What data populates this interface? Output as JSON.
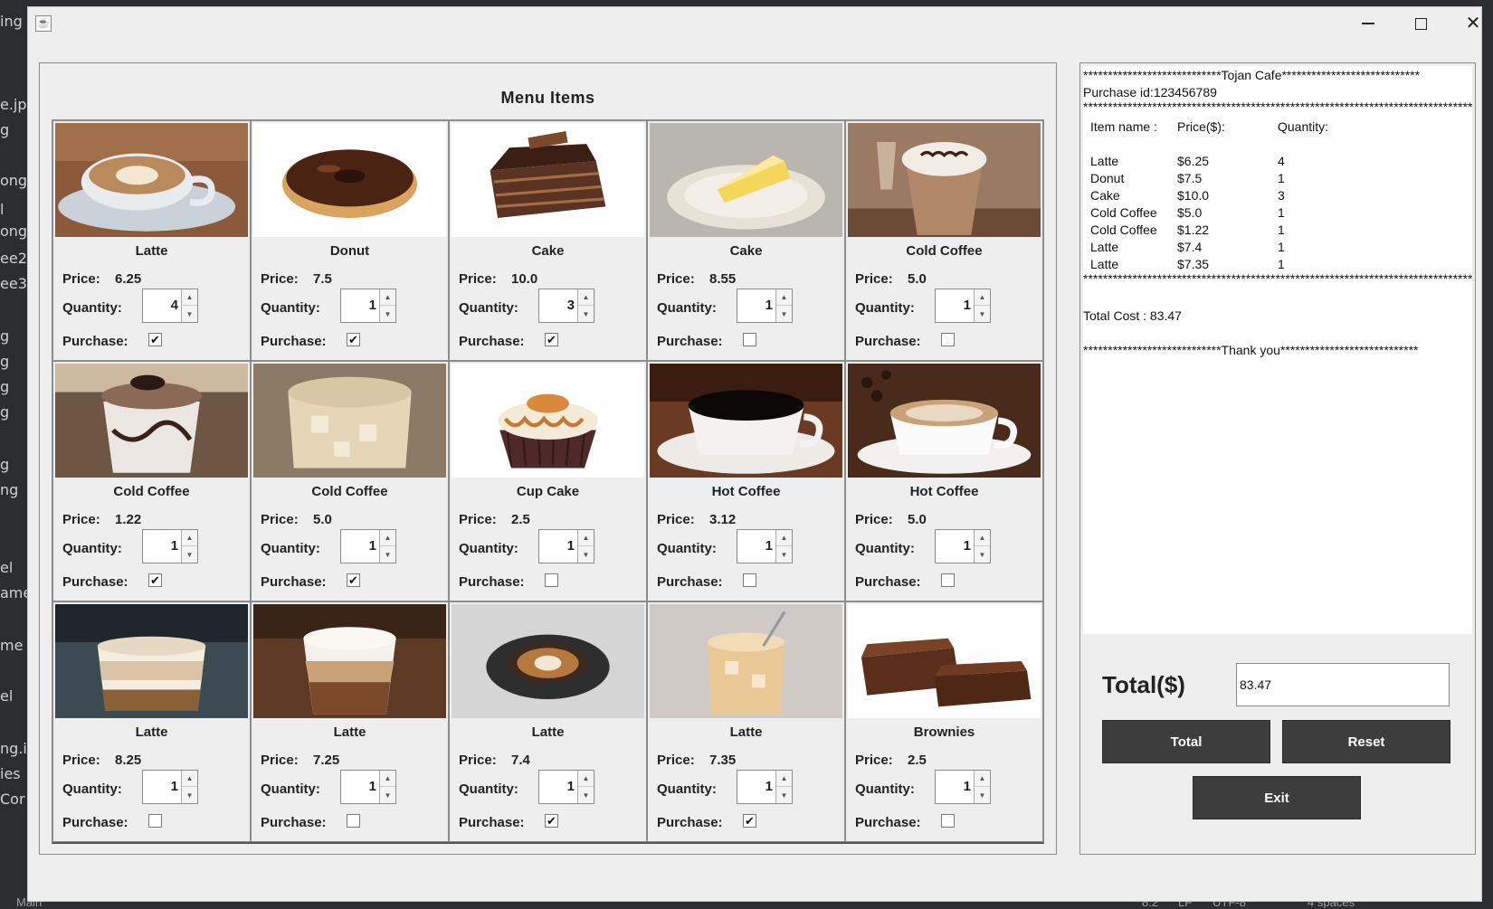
{
  "background": {
    "left_fragments": [
      "ing",
      "e.jpg",
      "g",
      "ong",
      "l",
      "ong",
      "ee2.",
      "ee3.j",
      "g",
      "g",
      "g",
      "g",
      "g",
      "ng",
      "el",
      "ame",
      "me",
      "el",
      "ng.i",
      "ies",
      "Cor"
    ],
    "status_items": [
      "Main",
      "8:2",
      "LF",
      "UTF-8",
      "4 spaces"
    ]
  },
  "menu": {
    "title": "Menu Items",
    "price_label": "Price:",
    "quantity_label": "Quantity:",
    "purchase_label": "Purchase:",
    "items": [
      {
        "name": "Latte",
        "price": "6.25",
        "qty": "4",
        "checked": "✔",
        "pic": "latte-cup"
      },
      {
        "name": "Donut",
        "price": "7.5",
        "qty": "1",
        "checked": "✔",
        "pic": "donut"
      },
      {
        "name": "Cake",
        "price": "10.0",
        "qty": "3",
        "checked": "✔",
        "pic": "choc-cake"
      },
      {
        "name": "Cake",
        "price": "8.55",
        "qty": "1",
        "checked": "",
        "pic": "cheese-cake"
      },
      {
        "name": "Cold Coffee",
        "price": "5.0",
        "qty": "1",
        "checked": "",
        "pic": "frappe"
      },
      {
        "name": "Cold Coffee",
        "price": "1.22",
        "qty": "1",
        "checked": "✔",
        "pic": "cold-cup"
      },
      {
        "name": "Cold Coffee",
        "price": "5.0",
        "qty": "1",
        "checked": "✔",
        "pic": "iced-glass"
      },
      {
        "name": "Cup Cake",
        "price": "2.5",
        "qty": "1",
        "checked": "",
        "pic": "cupcake"
      },
      {
        "name": "Hot Coffee",
        "price": "3.12",
        "qty": "1",
        "checked": "",
        "pic": "black-coffee"
      },
      {
        "name": "Hot Coffee",
        "price": "5.0",
        "qty": "1",
        "checked": "",
        "pic": "cappuccino"
      },
      {
        "name": "Latte",
        "price": "8.25",
        "qty": "1",
        "checked": "",
        "pic": "layered-cup"
      },
      {
        "name": "Latte",
        "price": "7.25",
        "qty": "1",
        "checked": "",
        "pic": "latte-glass"
      },
      {
        "name": "Latte",
        "price": "7.4",
        "qty": "1",
        "checked": "✔",
        "pic": "latte-top"
      },
      {
        "name": "Latte",
        "price": "7.35",
        "qty": "1",
        "checked": "✔",
        "pic": "iced-latte"
      },
      {
        "name": "Brownies",
        "price": "2.5",
        "qty": "1",
        "checked": "",
        "pic": "brownies"
      }
    ]
  },
  "receipt": {
    "header": "****************************Tojan Cafe****************************",
    "purchase_id": "Purchase id:123456789",
    "separator": "**************************************************************************************",
    "col_item": "Item name :",
    "col_price": "Price($):",
    "col_qty": "Quantity:",
    "rows": [
      {
        "item": "Latte",
        "price": "$6.25",
        "qty": "4"
      },
      {
        "item": "Donut",
        "price": "$7.5",
        "qty": "1"
      },
      {
        "item": "Cake",
        "price": "$10.0",
        "qty": "3"
      },
      {
        "item": "Cold Coffee",
        "price": "$5.0",
        "qty": "1"
      },
      {
        "item": "Cold Coffee",
        "price": "$1.22",
        "qty": "1"
      },
      {
        "item": "Latte",
        "price": "$7.4",
        "qty": "1"
      },
      {
        "item": "Latte",
        "price": "$7.35",
        "qty": "1"
      }
    ],
    "total_cost": "Total Cost : 83.47",
    "footer": "****************************Thank you****************************"
  },
  "controls": {
    "total_label": "Total($)",
    "total_value": "83.47",
    "total_button": "Total",
    "reset_button": "Reset",
    "exit_button": "Exit"
  },
  "window": {
    "app_icon": "java-cup-icon",
    "minimize_icon": "minimize-icon",
    "maximize_icon": "maximize-icon",
    "close_icon": "close-icon",
    "close_glyph": "✕"
  }
}
